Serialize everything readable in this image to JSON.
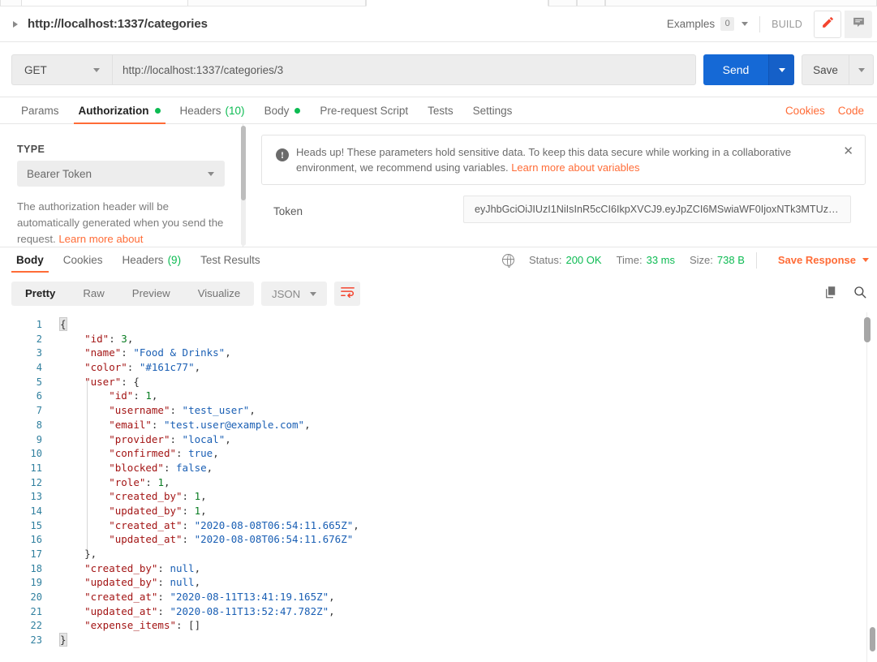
{
  "request_header": {
    "title": "http://localhost:1337/categories",
    "expand_icon": "caret-right-icon",
    "examples_label": "Examples",
    "examples_count": "0",
    "build_label": "BUILD",
    "edit_icon": "pencil-icon",
    "comment_icon": "comment-icon"
  },
  "url_bar": {
    "method": "GET",
    "url": "http://localhost:1337/categories/3",
    "send_label": "Send",
    "save_label": "Save"
  },
  "request_tabs": [
    {
      "label": "Params",
      "active": false,
      "badge": "",
      "badge_type": "none"
    },
    {
      "label": "Authorization",
      "active": true,
      "badge": "dot",
      "badge_type": "dot"
    },
    {
      "label": "Headers",
      "active": false,
      "badge": "(10)",
      "badge_type": "count"
    },
    {
      "label": "Body",
      "active": false,
      "badge": "dot",
      "badge_type": "dot"
    },
    {
      "label": "Pre-request Script",
      "active": false,
      "badge": "",
      "badge_type": "none"
    },
    {
      "label": "Tests",
      "active": false,
      "badge": "",
      "badge_type": "none"
    },
    {
      "label": "Settings",
      "active": false,
      "badge": "",
      "badge_type": "none"
    }
  ],
  "request_tabs_right": [
    {
      "label": "Cookies"
    },
    {
      "label": "Code"
    }
  ],
  "auth": {
    "type_label": "TYPE",
    "type_value": "Bearer Token",
    "description": "The authorization header will be automatically generated when you send the request. ",
    "description_link": "Learn more about",
    "notice": {
      "icon": "info-icon",
      "text": "Heads up! These parameters hold sensitive data. To keep this data secure while working in a collaborative environment, we recommend using variables. ",
      "link": "Learn more about variables",
      "close_icon": "close-icon"
    },
    "token_label": "Token",
    "token_value": "eyJhbGciOiJIUzI1NiIsInR5cCI6IkpXVCJ9.eyJpZCI6MSwiaWF0IjoxNTk3MTUz…"
  },
  "response_tabs": [
    {
      "label": "Body",
      "active": true,
      "badge": ""
    },
    {
      "label": "Cookies",
      "active": false,
      "badge": ""
    },
    {
      "label": "Headers",
      "active": false,
      "badge": "(9)"
    },
    {
      "label": "Test Results",
      "active": false,
      "badge": ""
    }
  ],
  "response_meta": {
    "globe_icon": "globe-icon",
    "status_label": "Status:",
    "status_value": "200 OK",
    "time_label": "Time:",
    "time_value": "33 ms",
    "size_label": "Size:",
    "size_value": "738 B",
    "save_response_label": "Save Response"
  },
  "body_toolbar": {
    "views": [
      {
        "label": "Pretty",
        "active": true
      },
      {
        "label": "Raw",
        "active": false
      },
      {
        "label": "Preview",
        "active": false
      },
      {
        "label": "Visualize",
        "active": false
      }
    ],
    "format": "JSON",
    "wrap_icon": "word-wrap-icon",
    "copy_icon": "copy-icon",
    "search_icon": "search-icon"
  },
  "response_body": {
    "language": "json",
    "lines": [
      {
        "no": "1",
        "indent": 0,
        "tokens": [
          {
            "t": "brace_hl",
            "v": "{"
          }
        ]
      },
      {
        "no": "2",
        "indent": 1,
        "tokens": [
          {
            "t": "k",
            "v": "\"id\""
          },
          {
            "t": "p",
            "v": ": "
          },
          {
            "t": "n",
            "v": "3"
          },
          {
            "t": "p",
            "v": ","
          }
        ]
      },
      {
        "no": "3",
        "indent": 1,
        "tokens": [
          {
            "t": "k",
            "v": "\"name\""
          },
          {
            "t": "p",
            "v": ": "
          },
          {
            "t": "s",
            "v": "\"Food & Drinks\""
          },
          {
            "t": "p",
            "v": ","
          }
        ]
      },
      {
        "no": "4",
        "indent": 1,
        "tokens": [
          {
            "t": "k",
            "v": "\"color\""
          },
          {
            "t": "p",
            "v": ": "
          },
          {
            "t": "s",
            "v": "\"#161c77\""
          },
          {
            "t": "p",
            "v": ","
          }
        ]
      },
      {
        "no": "5",
        "indent": 1,
        "tokens": [
          {
            "t": "k",
            "v": "\"user\""
          },
          {
            "t": "p",
            "v": ": {"
          }
        ]
      },
      {
        "no": "6",
        "indent": 2,
        "tokens": [
          {
            "t": "k",
            "v": "\"id\""
          },
          {
            "t": "p",
            "v": ": "
          },
          {
            "t": "n",
            "v": "1"
          },
          {
            "t": "p",
            "v": ","
          }
        ]
      },
      {
        "no": "7",
        "indent": 2,
        "tokens": [
          {
            "t": "k",
            "v": "\"username\""
          },
          {
            "t": "p",
            "v": ": "
          },
          {
            "t": "s",
            "v": "\"test_user\""
          },
          {
            "t": "p",
            "v": ","
          }
        ]
      },
      {
        "no": "8",
        "indent": 2,
        "tokens": [
          {
            "t": "k",
            "v": "\"email\""
          },
          {
            "t": "p",
            "v": ": "
          },
          {
            "t": "s",
            "v": "\"test.user@example.com\""
          },
          {
            "t": "p",
            "v": ","
          }
        ]
      },
      {
        "no": "9",
        "indent": 2,
        "tokens": [
          {
            "t": "k",
            "v": "\"provider\""
          },
          {
            "t": "p",
            "v": ": "
          },
          {
            "t": "s",
            "v": "\"local\""
          },
          {
            "t": "p",
            "v": ","
          }
        ]
      },
      {
        "no": "10",
        "indent": 2,
        "tokens": [
          {
            "t": "k",
            "v": "\"confirmed\""
          },
          {
            "t": "p",
            "v": ": "
          },
          {
            "t": "s",
            "v": "true"
          },
          {
            "t": "p",
            "v": ","
          }
        ]
      },
      {
        "no": "11",
        "indent": 2,
        "tokens": [
          {
            "t": "k",
            "v": "\"blocked\""
          },
          {
            "t": "p",
            "v": ": "
          },
          {
            "t": "s",
            "v": "false"
          },
          {
            "t": "p",
            "v": ","
          }
        ]
      },
      {
        "no": "12",
        "indent": 2,
        "tokens": [
          {
            "t": "k",
            "v": "\"role\""
          },
          {
            "t": "p",
            "v": ": "
          },
          {
            "t": "n",
            "v": "1"
          },
          {
            "t": "p",
            "v": ","
          }
        ]
      },
      {
        "no": "13",
        "indent": 2,
        "tokens": [
          {
            "t": "k",
            "v": "\"created_by\""
          },
          {
            "t": "p",
            "v": ": "
          },
          {
            "t": "n",
            "v": "1"
          },
          {
            "t": "p",
            "v": ","
          }
        ]
      },
      {
        "no": "14",
        "indent": 2,
        "tokens": [
          {
            "t": "k",
            "v": "\"updated_by\""
          },
          {
            "t": "p",
            "v": ": "
          },
          {
            "t": "n",
            "v": "1"
          },
          {
            "t": "p",
            "v": ","
          }
        ]
      },
      {
        "no": "15",
        "indent": 2,
        "tokens": [
          {
            "t": "k",
            "v": "\"created_at\""
          },
          {
            "t": "p",
            "v": ": "
          },
          {
            "t": "s",
            "v": "\"2020-08-08T06:54:11.665Z\""
          },
          {
            "t": "p",
            "v": ","
          }
        ]
      },
      {
        "no": "16",
        "indent": 2,
        "tokens": [
          {
            "t": "k",
            "v": "\"updated_at\""
          },
          {
            "t": "p",
            "v": ": "
          },
          {
            "t": "s",
            "v": "\"2020-08-08T06:54:11.676Z\""
          }
        ]
      },
      {
        "no": "17",
        "indent": 1,
        "tokens": [
          {
            "t": "p",
            "v": "},"
          }
        ]
      },
      {
        "no": "18",
        "indent": 1,
        "tokens": [
          {
            "t": "k",
            "v": "\"created_by\""
          },
          {
            "t": "p",
            "v": ": "
          },
          {
            "t": "s",
            "v": "null"
          },
          {
            "t": "p",
            "v": ","
          }
        ]
      },
      {
        "no": "19",
        "indent": 1,
        "tokens": [
          {
            "t": "k",
            "v": "\"updated_by\""
          },
          {
            "t": "p",
            "v": ": "
          },
          {
            "t": "s",
            "v": "null"
          },
          {
            "t": "p",
            "v": ","
          }
        ]
      },
      {
        "no": "20",
        "indent": 1,
        "tokens": [
          {
            "t": "k",
            "v": "\"created_at\""
          },
          {
            "t": "p",
            "v": ": "
          },
          {
            "t": "s",
            "v": "\"2020-08-11T13:41:19.165Z\""
          },
          {
            "t": "p",
            "v": ","
          }
        ]
      },
      {
        "no": "21",
        "indent": 1,
        "tokens": [
          {
            "t": "k",
            "v": "\"updated_at\""
          },
          {
            "t": "p",
            "v": ": "
          },
          {
            "t": "s",
            "v": "\"2020-08-11T13:52:47.782Z\""
          },
          {
            "t": "p",
            "v": ","
          }
        ]
      },
      {
        "no": "22",
        "indent": 1,
        "tokens": [
          {
            "t": "k",
            "v": "\"expense_items\""
          },
          {
            "t": "p",
            "v": ": []"
          }
        ]
      },
      {
        "no": "23",
        "indent": 0,
        "tokens": [
          {
            "t": "brace_hl",
            "v": "}"
          }
        ]
      }
    ]
  },
  "colors": {
    "accent_orange": "#ff6c37",
    "send_blue": "#1569d6",
    "status_green": "#0cbb52",
    "json_key": "#a31515",
    "json_string": "#1a5fb4",
    "json_number": "#0a7d23",
    "line_number": "#2f7f9e"
  }
}
